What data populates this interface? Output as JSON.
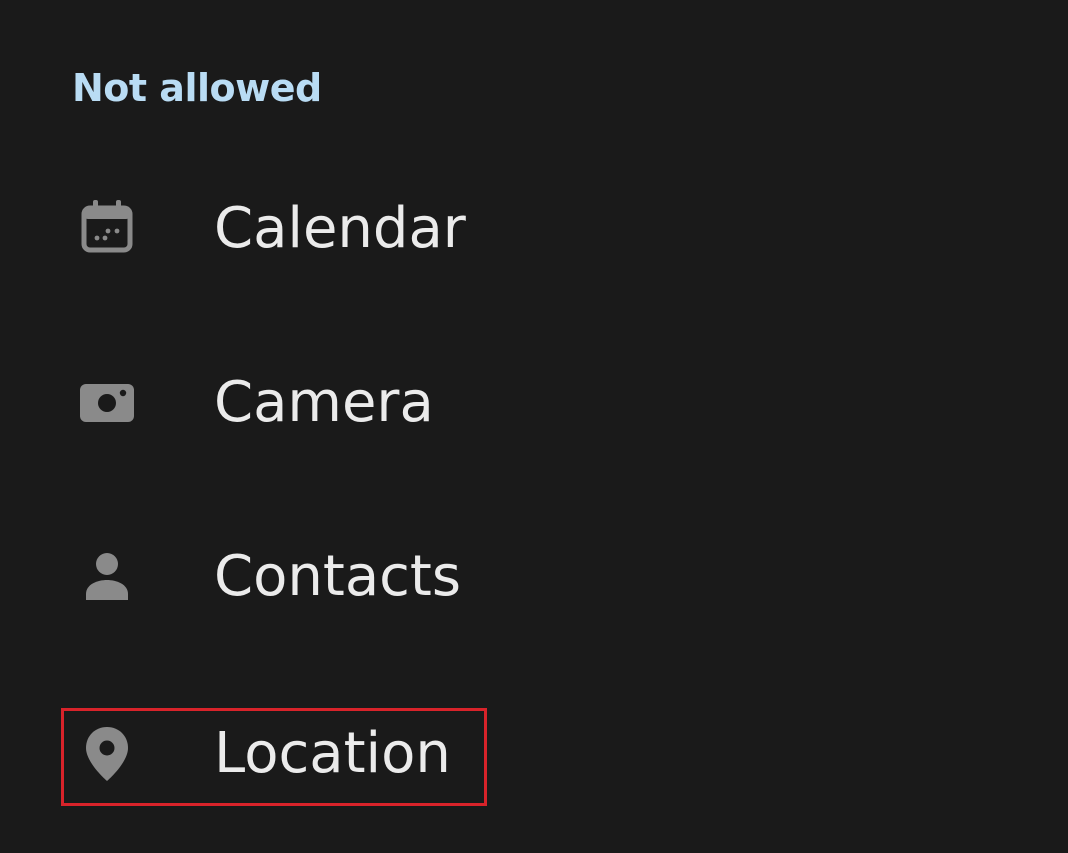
{
  "section": {
    "title": "Not allowed"
  },
  "permissions": [
    {
      "label": "Calendar",
      "icon": "calendar-icon"
    },
    {
      "label": "Camera",
      "icon": "camera-icon"
    },
    {
      "label": "Contacts",
      "icon": "person-icon"
    },
    {
      "label": "Location",
      "icon": "location-pin-icon",
      "highlighted": true
    }
  ],
  "colors": {
    "background": "#1a1a1a",
    "header": "#b9dcf4",
    "label": "#ebebeb",
    "icon": "#8a8a8a",
    "highlight": "#d8232a"
  }
}
